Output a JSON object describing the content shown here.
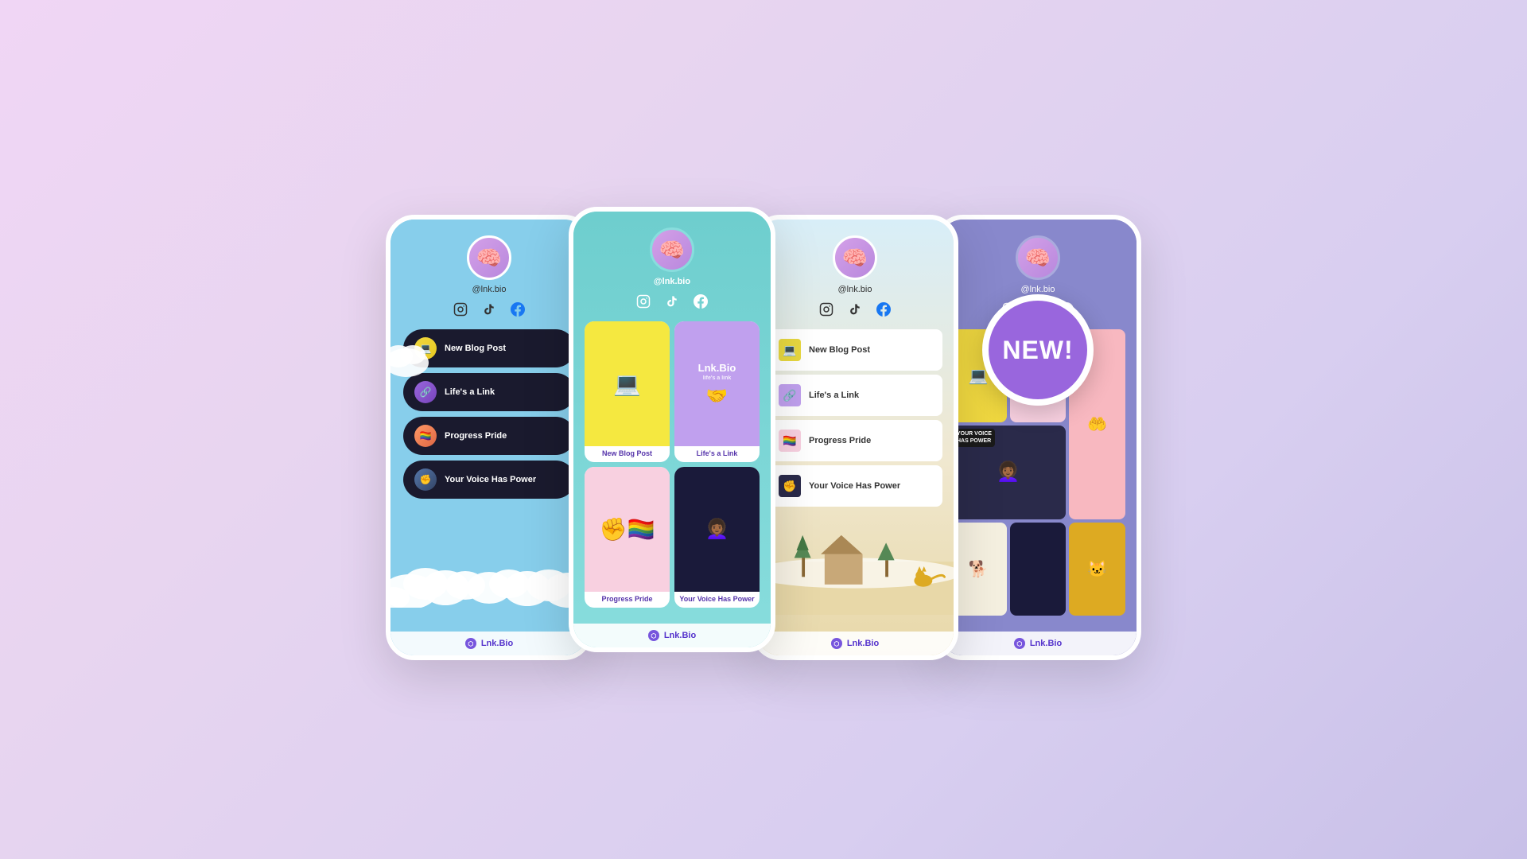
{
  "page": {
    "background": "gradient lavender to periwinkle",
    "new_badge": {
      "label": "NEW!"
    }
  },
  "phones": [
    {
      "id": "phone-1",
      "theme": "sky-blue-clouds",
      "username": "@lnk.bio",
      "social_icons": [
        "instagram",
        "tiktok",
        "facebook"
      ],
      "links": [
        {
          "label": "New Blog Post",
          "icon_color": "#e8c840"
        },
        {
          "label": "Life's a Link",
          "icon_color": "#9966dd"
        },
        {
          "label": "Progress Pride",
          "icon_color": "#dd8844"
        },
        {
          "label": "Your Voice Has Power",
          "icon_color": "#446688"
        }
      ],
      "footer": "Lnk.Bio"
    },
    {
      "id": "phone-2",
      "theme": "teal-gradient",
      "username": "@lnk.bio",
      "social_icons": [
        "instagram",
        "tiktok",
        "facebook"
      ],
      "grid_cards": [
        {
          "label": "New Blog Post",
          "bg": "yellow",
          "type": "computer"
        },
        {
          "label": "Life's a Link",
          "bg": "purple",
          "type": "lnkbio"
        },
        {
          "label": "Progress Pride",
          "bg": "pink",
          "type": "pride-flag"
        },
        {
          "label": "Your Voice Has Power",
          "bg": "dark",
          "type": "person"
        }
      ],
      "footer": "Lnk.Bio"
    },
    {
      "id": "phone-3",
      "theme": "light-airy",
      "username": "@lnk.bio",
      "social_icons": [
        "instagram",
        "tiktok",
        "facebook"
      ],
      "links": [
        {
          "label": "New Blog Post"
        },
        {
          "label": "Life's a Link"
        },
        {
          "label": "Progress Pride"
        },
        {
          "label": "Your Voice Has Power"
        }
      ],
      "footer": "Lnk.Bio"
    },
    {
      "id": "phone-4",
      "theme": "periwinkle",
      "username": "@lnk.bio",
      "social_icons": [
        "instagram",
        "tiktok",
        "facebook"
      ],
      "mosaic": [
        {
          "type": "computer-yellow",
          "col": 1
        },
        {
          "type": "rainbow-flag",
          "col": 1
        },
        {
          "type": "woman-colorful",
          "col": 1
        },
        {
          "type": "dog",
          "col": 1
        },
        {
          "type": "dark",
          "col": 1
        }
      ],
      "footer": "Lnk.Bio"
    }
  ]
}
